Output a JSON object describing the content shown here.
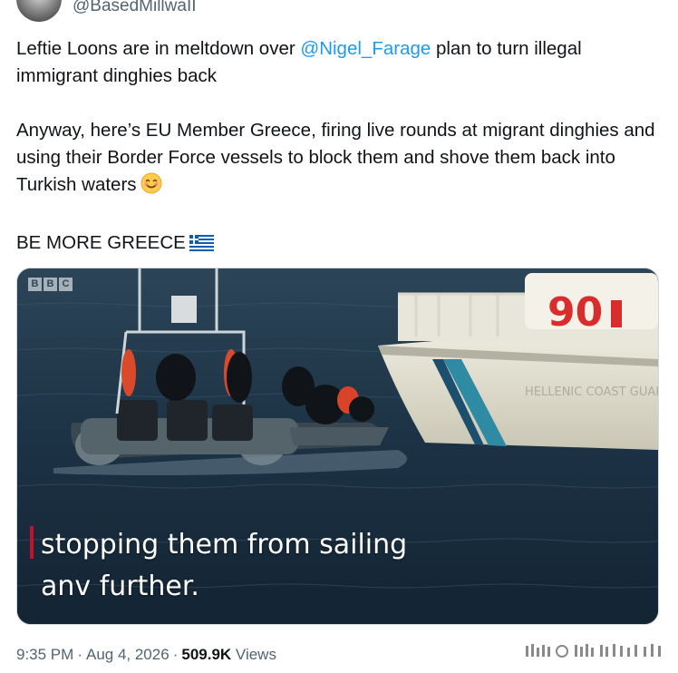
{
  "header": {
    "handle": "@BasedMillwaII"
  },
  "tweet": {
    "line1_pre": "Leftie Loons are in meltdown over ",
    "mention": "@Nigel_Farage",
    "line1_post": " plan to turn illegal immigrant dinghies back",
    "para2": "Anyway, here’s EU Member Greece, firing live rounds at migrant dinghies and using their Border Force vessels to block them and shove them back into Turkish waters",
    "para2_emoji": "smiling-face-emoji",
    "para3": "BE MORE GREECE",
    "para3_emoji": "greece-flag-emoji"
  },
  "media": {
    "logo_letters": [
      "B",
      "B",
      "C"
    ],
    "subtitle_line1": "stopping them from sailing",
    "subtitle_line2": "anv further.",
    "vessel_number": "90",
    "vessel_text": "HELLENIC COAST GUARD"
  },
  "meta": {
    "time": "9:35 PM",
    "separator": "·",
    "date": "Aug 4, 2026",
    "views_count": "509.9K",
    "views_label": "Views"
  },
  "colors": {
    "link": "#1d9bf0",
    "text": "#0f1419",
    "muted": "#536471",
    "sea": "#1d3346"
  }
}
